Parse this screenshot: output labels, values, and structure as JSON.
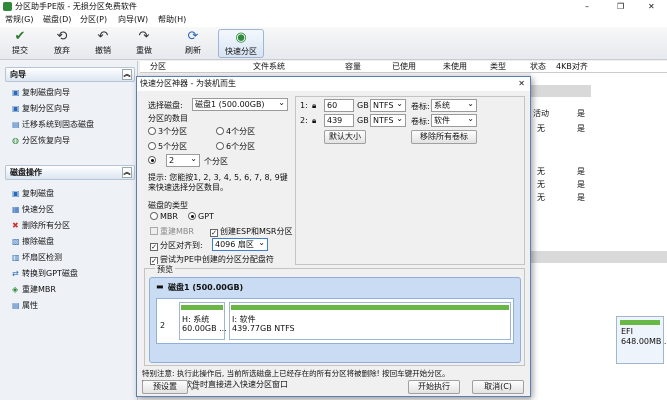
{
  "app": {
    "title": "分区助手PE版 - 无损分区免费软件"
  },
  "window_controls": {
    "minimize": "–",
    "restore": "❐",
    "close": "✕"
  },
  "menu": [
    "常规(G)",
    "磁盘(D)",
    "分区(P)",
    "向导(W)",
    "帮助(H)"
  ],
  "toolbar": [
    {
      "label": "提交",
      "icon": "check-icon"
    },
    {
      "label": "放弃",
      "icon": "discard-icon"
    },
    {
      "label": "撤销",
      "icon": "undo-icon"
    },
    {
      "label": "重做",
      "icon": "redo-icon"
    },
    {
      "label": "刷新",
      "icon": "refresh-icon"
    },
    {
      "label": "快速分区",
      "icon": "quick-partition-icon"
    }
  ],
  "sidebar": {
    "wizard_title": "向导",
    "wizard_items": [
      "复制磁盘向导",
      "复制分区向导",
      "迁移系统到固态磁盘",
      "分区恢复向导"
    ],
    "disk_title": "磁盘操作",
    "disk_items": [
      "复制磁盘",
      "快速分区",
      "删除所有分区",
      "擦除磁盘",
      "坏扇区检测",
      "转换到GPT磁盘",
      "重建MBR",
      "属性"
    ]
  },
  "table": {
    "headers": [
      "分区",
      "文件系统",
      "容量",
      "已使用",
      "未使用",
      "类型",
      "状态",
      "4KB对齐"
    ],
    "bg_cells": [
      "活动",
      "是",
      "无",
      "是",
      "无",
      "是",
      "无",
      "是",
      "无",
      "是"
    ]
  },
  "dialog": {
    "title": "快速分区神器 - 为装机而生",
    "close": "✕",
    "select_disk_label": "选择磁盘:",
    "select_disk_value": "磁盘1 (500.00GB)",
    "count_label": "分区的数目",
    "count_options": [
      "3个分区",
      "4个分区",
      "5个分区",
      "6个分区"
    ],
    "custom_count": "2",
    "custom_count_suffix": "个分区",
    "hint": "提示: 您能按1, 2, 3, 4, 5, 6, 7, 8, 9键来快速选择分区数目。",
    "disk_type_label": "磁盘的类型",
    "mbr": "MBR",
    "gpt": "GPT",
    "rebuild_mbr": "重建MBR",
    "create_esp": "创建ESP和MSR分区",
    "align_label": "分区对齐到:",
    "align_value": "4096 扇区",
    "pe_boot": "尝试为PE中创建的分区分配盘符",
    "partitions": [
      {
        "num": "1:",
        "size": "60",
        "unit": "GB",
        "fs": "NTFS",
        "vol_label_text": "卷标:",
        "vol": "系统"
      },
      {
        "num": "2:",
        "size": "439",
        "unit": "GB",
        "fs": "NTFS",
        "vol_label_text": "卷标:",
        "vol": "软件"
      }
    ],
    "default_size_btn": "默认大小",
    "remove_labels_btn": "移除所有卷标",
    "preview_label": "预览",
    "preview_disk": "磁盘1 (500.00GB)",
    "preview_num": "2",
    "preview_parts": [
      {
        "name": "H: 系统",
        "info": "60.00GB ...",
        "fill": 0.2
      },
      {
        "name": "I: 软件",
        "info": "439.77GB NTFS",
        "fill": 0.15
      }
    ],
    "warning": "特别注意: 执行此操作后, 当前所选磁盘上已经存在的所有分区将被删除! 按回车键开始分区。",
    "no_restart": "下次启动软件时直接进入快速分区窗口",
    "advanced_btn": "预设置",
    "start_btn": "开始执行",
    "cancel_btn": "取消(C)"
  },
  "right_pane": {
    "label_prefix": "EFI",
    "info": "648.00MB ..."
  }
}
